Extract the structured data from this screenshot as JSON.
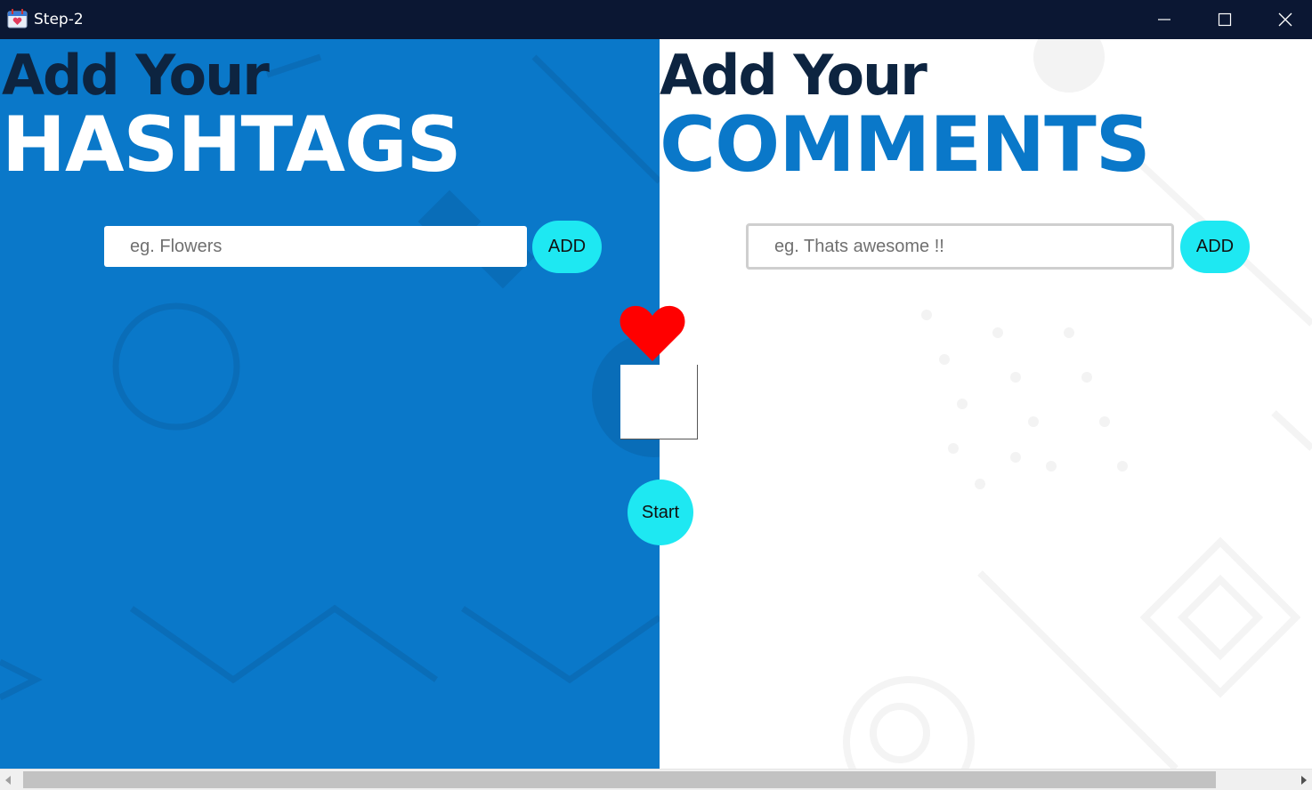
{
  "window": {
    "title": "Step-2",
    "icon": "calendar-heart-icon",
    "controls": [
      "minimize-icon",
      "maximize-icon",
      "close-icon"
    ]
  },
  "left_panel": {
    "heading_small": "Add Your",
    "heading_big": "HASHTAGS",
    "input_placeholder": "eg. Flowers",
    "input_value": "",
    "add_label": "ADD",
    "background_color": "#0a78c9"
  },
  "right_panel": {
    "heading_small": "Add Your",
    "heading_big": "COMMENTS",
    "input_placeholder": "eg. Thats awesome !!",
    "input_value": "",
    "add_label": "ADD",
    "background_color": "#ffffff"
  },
  "center": {
    "heart_icon": "heart-icon",
    "start_label": "Start"
  },
  "colors": {
    "accent_cyan": "#1ee8f2",
    "brand_blue": "#0a78c9",
    "heading_dark": "#0d2440",
    "heart_red": "#ff0000",
    "titlebar": "#0b1733"
  }
}
